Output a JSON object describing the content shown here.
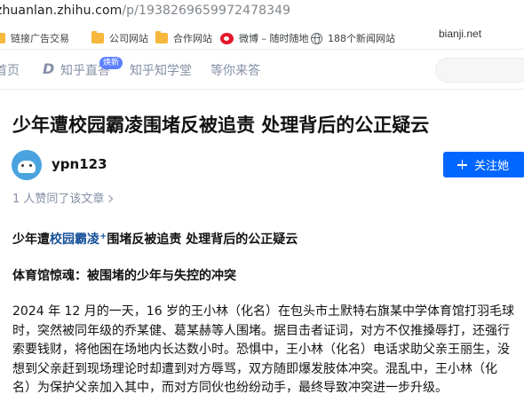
{
  "browser": {
    "address_host": "zhuanlan.zhihu.com",
    "address_path": "/p/1938269659972478349",
    "bookmarks": [
      {
        "label": "链接广告交易",
        "icon": "folder-icon"
      },
      {
        "label": "公司网站",
        "icon": "folder-icon"
      },
      {
        "label": "合作网站",
        "icon": "folder-icon"
      },
      {
        "label": "微博 – 随时随地",
        "icon": "weibo-icon"
      },
      {
        "label": "188个新闻网站",
        "icon": "globe-icon"
      }
    ]
  },
  "watermark": "bianji.net",
  "nav": {
    "items": [
      {
        "label": "首页"
      },
      {
        "label": "知乎直答"
      },
      {
        "label": "知乎知学堂"
      },
      {
        "label": "等你来答"
      }
    ],
    "badge": "焕新"
  },
  "article": {
    "title": "少年遭校园霸凌围堵反被追责 处理背后的公正疑云",
    "author": "ypn123",
    "follow_label": "关注她",
    "likes": "1 人赞同了该文章",
    "subtitle_prefix": "少年遭",
    "subtitle_link": "校园霸凌",
    "subtitle_mark": "+",
    "subtitle_suffix": "围堵反被追责 处理背后的公正疑云",
    "section_heading": "体育馆惊魂：被围堵的少年与失控的冲突",
    "paragraph_lines": [
      "2024 年 12 月的一天，16 岁的王小林（化名）在包头市土默特右旗某中学体育馆打羽毛球",
      "时，突然被同年级的乔某健、葛某赫等人围堵。据目击者证词，对方不仅推搡辱打，还强行",
      "索要钱财，将他困在场地内长达数小时。恐惧中，王小林（化名）电话求助父亲王丽生，没",
      "想到父亲赶到现场理论时却遭到对方辱骂，双方随即爆发肢体冲突。混乱中，王小林（化",
      "名）为保护父亲加入其中，而对方同伙也纷纷动手，最终导致冲突进一步升级。"
    ]
  },
  "colors": {
    "accent": "#0066ff",
    "link": "#175199",
    "muted": "#8590a6"
  }
}
